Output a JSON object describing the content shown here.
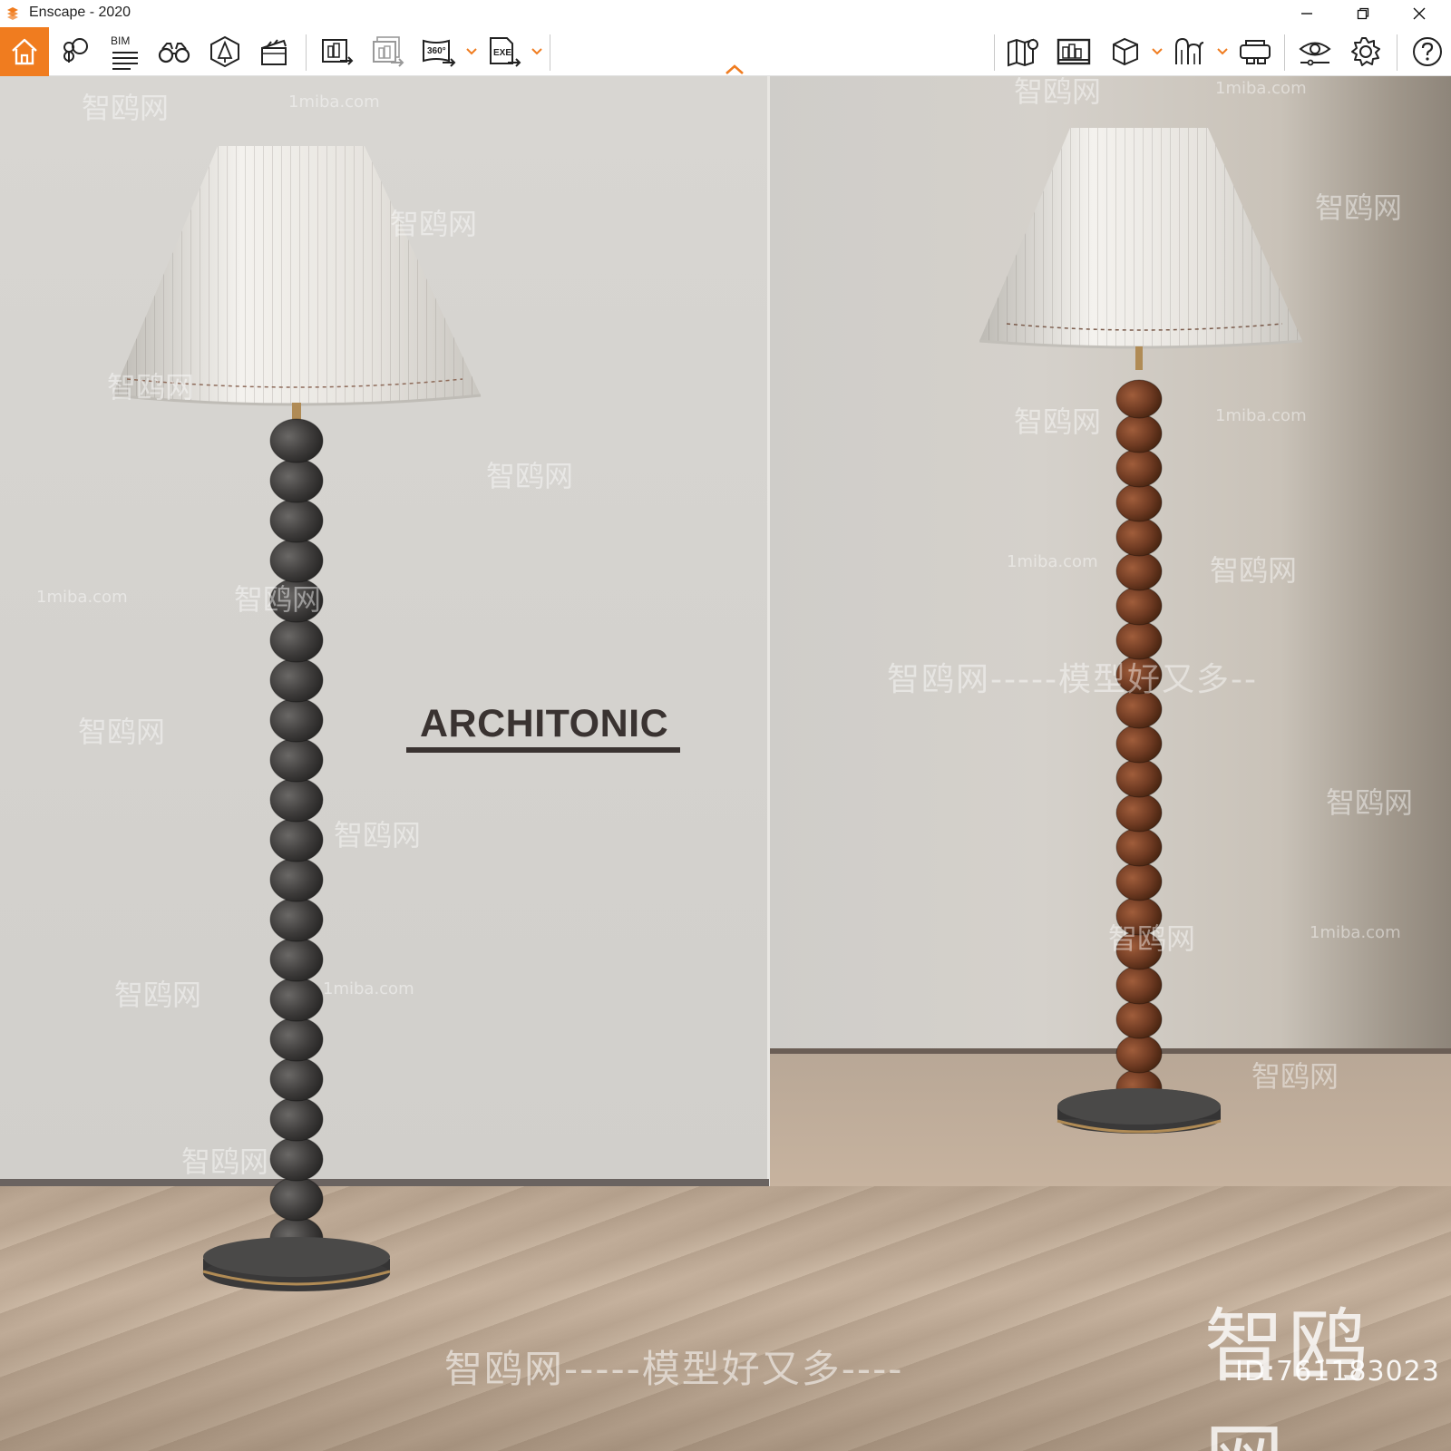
{
  "window": {
    "title": "Enscape - 2020"
  },
  "toolbar": {
    "bim_label": "BIM",
    "icons": {
      "home": "home-icon",
      "views": "location-pins-icon",
      "bim": "bim-list-icon",
      "binoculars": "binoculars-icon",
      "asset": "asset-library-icon",
      "video": "clapperboard-icon",
      "screenshot": "export-image-icon",
      "batch": "batch-render-icon",
      "panorama": "export-360-icon",
      "exe": "export-exe-icon",
      "map": "map-icon",
      "panorama_gallery": "panorama-gallery-icon",
      "cube": "cube-icon",
      "vr": "vr-headset-icon",
      "eye": "visual-settings-icon",
      "gear": "settings-icon",
      "help": "help-icon"
    },
    "accent": "#f07c1f"
  },
  "viewport": {
    "brand_text": "ARCHITONIC",
    "watermarks": {
      "cn_small": "智鸥网",
      "site": "1miba.com",
      "bottom": "智鸥网-----模型好又多----",
      "mid": "智鸥网-----模型好又多--",
      "big": "智鸥网",
      "id": "ID:761183023"
    }
  }
}
